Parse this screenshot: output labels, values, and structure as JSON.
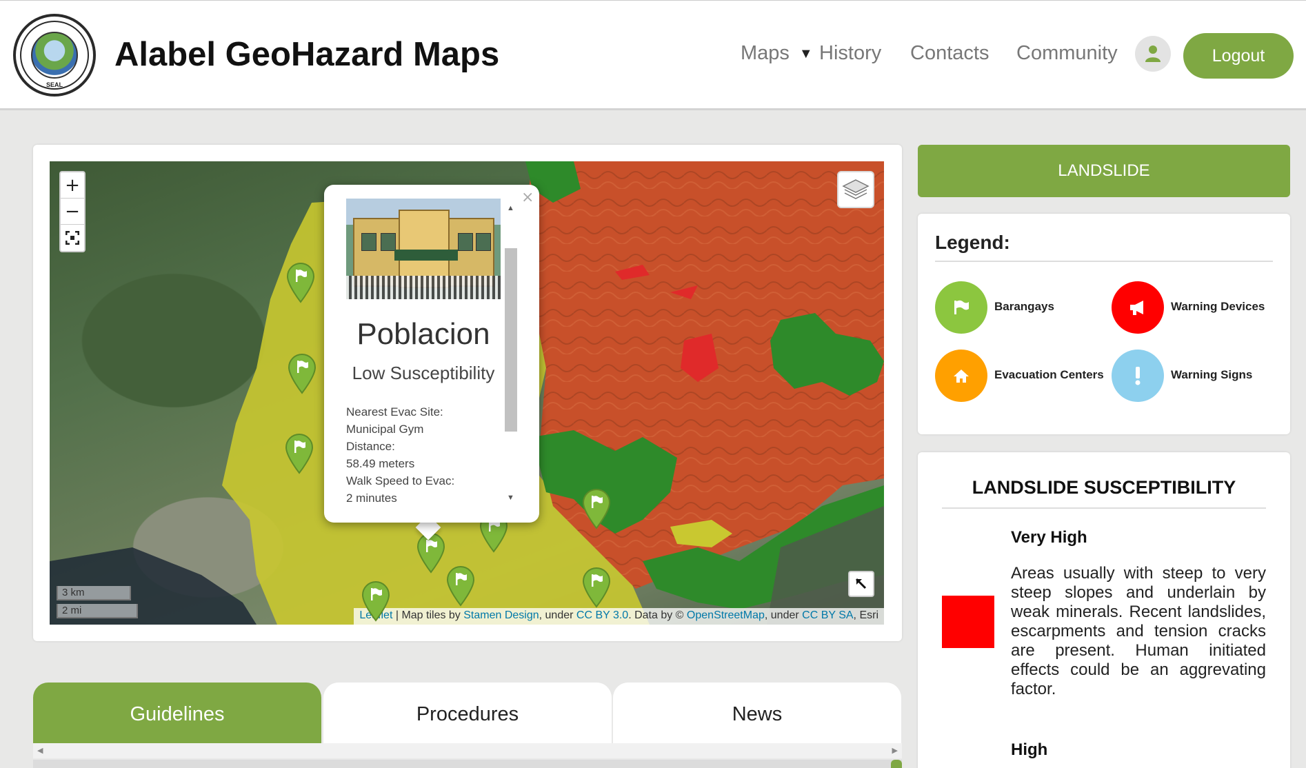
{
  "header": {
    "seal_text": "SEAL",
    "title": "Alabel GeoHazard Maps",
    "nav": {
      "maps": "Maps",
      "history": "History",
      "contacts": "Contacts",
      "community": "Community"
    },
    "user_icon": "user-icon",
    "logout": "Logout"
  },
  "map": {
    "zoom_in": "+",
    "zoom_out": "−",
    "fullscreen_icon": "fullscreen-icon",
    "layers_icon": "layers-icon",
    "expand_icon": "expand-arrow-icon",
    "scale_km": "3 km",
    "scale_mi": "2 mi",
    "attribution": {
      "leaflet": "Leaflet",
      "sep1": " | Map tiles by ",
      "stamen": "Stamen Design",
      "sep2": ", under ",
      "ccby": "CC BY 3.0",
      "sep3": ". Data by © ",
      "osm": "OpenStreetMap",
      "sep4": ", under ",
      "ccbysa": "CC BY SA",
      "sep5": ", Esri"
    },
    "colors": {
      "very_high": "#c8502a",
      "moderate": "#c9c830",
      "low": "#2e8a2a",
      "marker": "#7fb83a"
    },
    "popup": {
      "close": "×",
      "name": "Poblacion",
      "susceptibility": "Low Susceptibility",
      "lines": [
        "Nearest Evac Site:",
        "Municipal Gym",
        "Distance:",
        "58.49 meters",
        "Walk Speed to Evac:",
        "2 minutes"
      ]
    }
  },
  "sidebar": {
    "hazard_button": "LANDSLIDE",
    "legend": {
      "title": "Legend:",
      "items": [
        {
          "label": "Barangays",
          "color": "#8cc63f",
          "icon": "flag-icon"
        },
        {
          "label": "Warning Devices",
          "color": "#ff0000",
          "icon": "megaphone-icon"
        },
        {
          "label": "Evacuation Centers",
          "color": "#ffa000",
          "icon": "home-icon"
        },
        {
          "label": "Warning Signs",
          "color": "#8dd0ee",
          "icon": "exclamation-icon"
        }
      ]
    },
    "susceptibility": {
      "title": "LANDSLIDE SUSCEPTIBILITY",
      "levels": [
        {
          "name": "Very High",
          "color": "#ff0000",
          "description": "Areas usually with steep to very steep slopes and underlain by weak minerals. Recent landslides, escarpments and tension cracks are present. Human initiated effects could be an aggrevating factor."
        },
        {
          "name": "High"
        }
      ]
    }
  },
  "tabs": [
    "Guidelines",
    "Procedures",
    "News"
  ]
}
